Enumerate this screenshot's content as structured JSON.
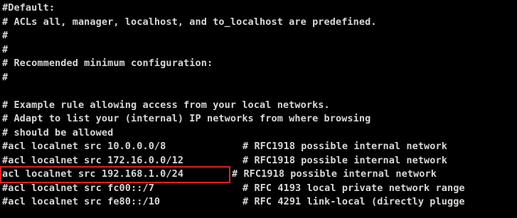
{
  "terminal": {
    "lines": [
      {
        "code": "#Default:",
        "comment": ""
      },
      {
        "code": "# ACLs all, manager, localhost, and to_localhost are predefined.",
        "comment": ""
      },
      {
        "code": "#",
        "comment": ""
      },
      {
        "code": "#",
        "comment": ""
      },
      {
        "code": "# Recommended minimum configuration:",
        "comment": ""
      },
      {
        "code": "#",
        "comment": ""
      },
      {
        "code": "",
        "comment": ""
      },
      {
        "code": "# Example rule allowing access from your local networks.",
        "comment": ""
      },
      {
        "code": "# Adapt to list your (internal) IP networks from where browsing",
        "comment": ""
      },
      {
        "code": "# should be allowed",
        "comment": ""
      },
      {
        "code": "#acl localnet src 10.0.0.0/8",
        "comment": "# RFC1918 possible internal network"
      },
      {
        "code": "#acl localnet src 172.16.0.0/12",
        "comment": "# RFC1918 possible internal network"
      },
      {
        "code": "acl localnet src 192.168.1.0/24",
        "comment": "# RFC1918 possible internal network"
      },
      {
        "code": "#acl localnet src fc00::/7",
        "comment": "# RFC 4193 local private network range"
      },
      {
        "code": "#acl localnet src fe80::/10",
        "comment": "# RFC 4291 link-local (directly plugge"
      }
    ],
    "colors": {
      "background": "#000000",
      "text": "#d8d8d8",
      "highlight_border": "#e02020"
    }
  }
}
